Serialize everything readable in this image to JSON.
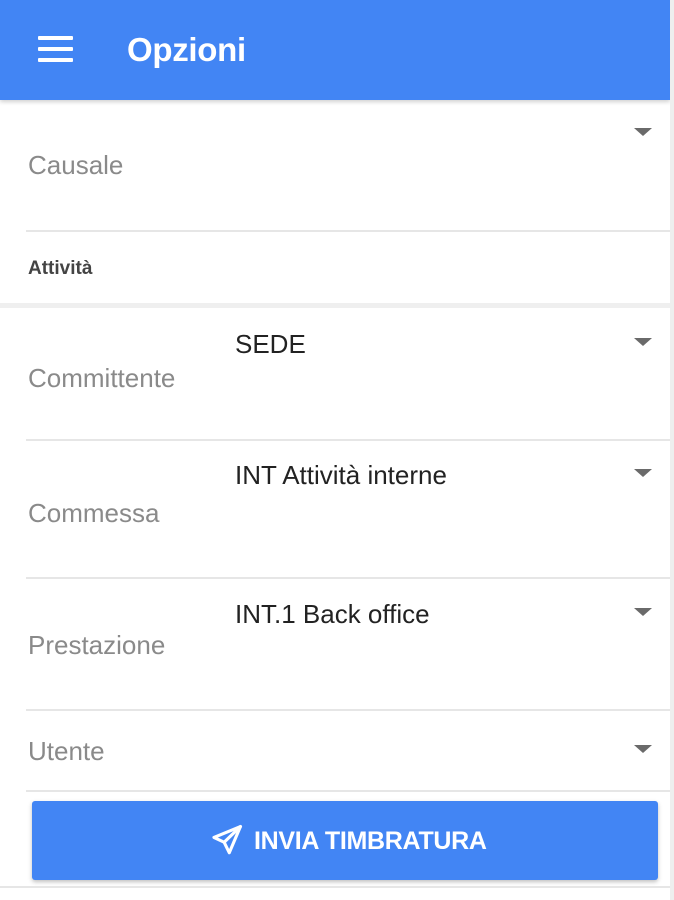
{
  "header": {
    "title": "Opzioni"
  },
  "fields": {
    "causale": {
      "label": "Causale",
      "value": ""
    },
    "committente": {
      "label": "Committente",
      "value": "SEDE"
    },
    "commessa": {
      "label": "Commessa",
      "value": "INT Attività interne"
    },
    "prestazione": {
      "label": "Prestazione",
      "value": "INT.1 Back office"
    },
    "utente": {
      "label": "Utente",
      "value": ""
    }
  },
  "section": {
    "title": "Attività"
  },
  "actions": {
    "submit_label": "INVIA TIMBRATURA"
  },
  "icons": {
    "menu": "menu-icon",
    "dropdown": "caret-down-icon",
    "send": "paper-plane-icon"
  },
  "colors": {
    "primary": "#4285f4",
    "label": "#8a8a8a",
    "value": "#222222"
  }
}
